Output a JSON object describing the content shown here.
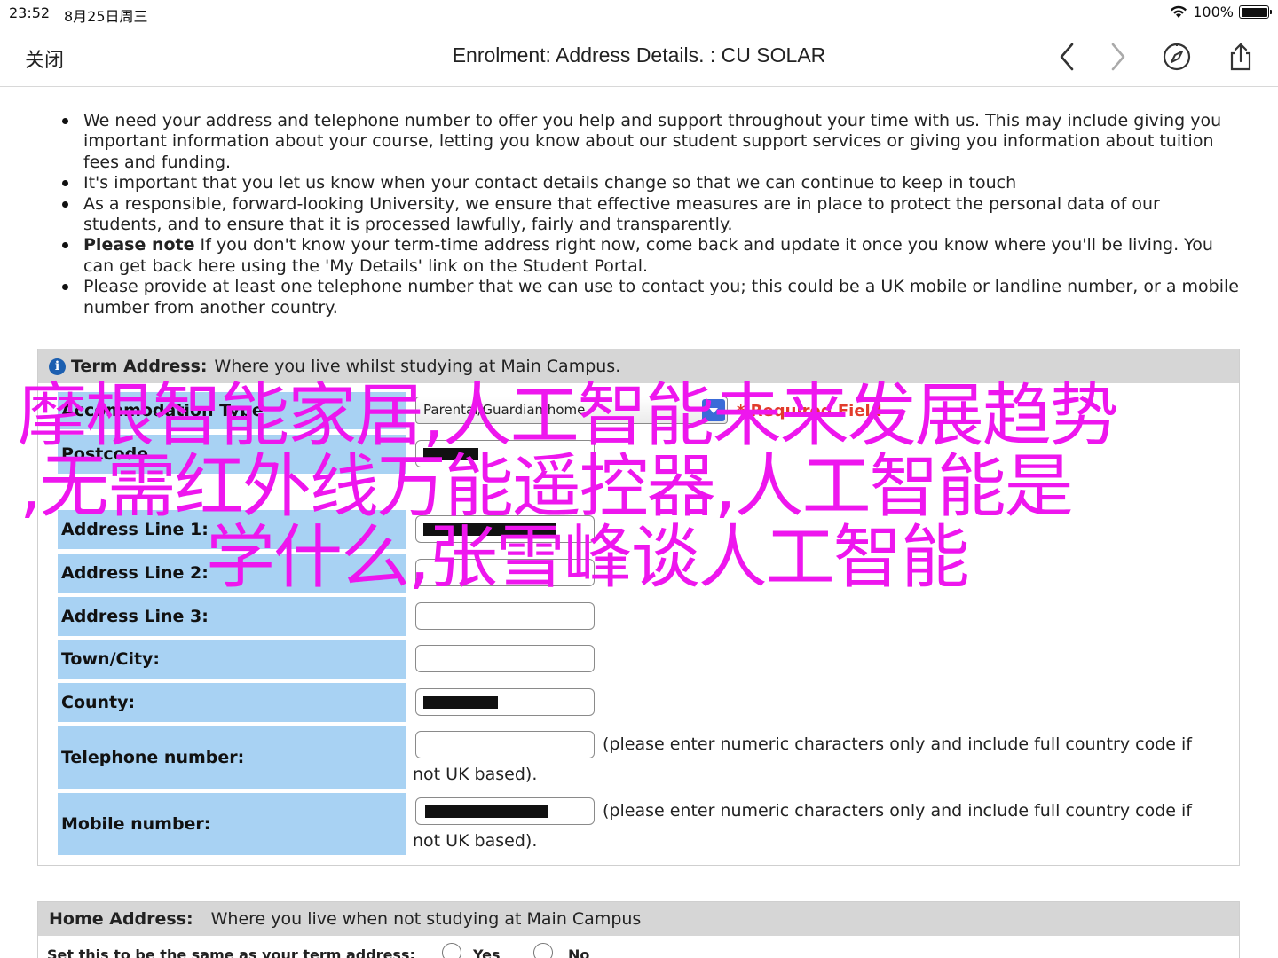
{
  "status": {
    "time": "23:52",
    "date": "8月25日周三",
    "battery": "100%"
  },
  "nav": {
    "close_label": "关闭",
    "title": "Enrolment: Address Details. : CU SOLAR"
  },
  "intro": [
    "We need your address and telephone number to offer you help and support throughout your time with us. This may include giving you important information about your course, letting you know about our student support services or giving you information about tuition fees and funding.",
    "It's important that you let us know when your contact details change so that we can continue to keep in touch",
    "As a responsible, forward-looking University, we ensure that effective measures are in place to protect the personal data of our students, and to ensure that it is processed lawfully, fairly and transparently."
  ],
  "intro_note": {
    "bold": "Please note",
    "text": " If you don't know your term-time address right now, come back and update it once you know where you'll be living. You can get back here using the 'My Details' link on the Student Portal."
  },
  "intro_last": "Please provide at least one telephone number that we can use to contact you; this could be a UK mobile or landline number, or a mobile number from another country.",
  "term": {
    "heading_bold": "Term Address:",
    "heading_text": "Where you live whilst studying at Main Campus.",
    "accommodation_label": "Accommodation Type",
    "accommodation_value": "Parental/Guardian home",
    "required": "* Required Field",
    "postcode_label": "Postcode",
    "line1_label": "Address Line 1:",
    "line2_label": "Address Line 2:",
    "line3_label": "Address Line 3:",
    "town_label": "Town/City:",
    "county_label": "County:",
    "telephone_label": "Telephone number:",
    "telephone_hint_1": "(please enter numeric characters only and include full country code if",
    "telephone_hint_2": "not UK based).",
    "mobile_label": "Mobile number:",
    "mobile_hint_1": "(please enter numeric characters only and include full country code if",
    "mobile_hint_2": "not UK based)."
  },
  "home": {
    "heading_bold": "Home Address:",
    "heading_text": "Where you live when not studying at Main Campus",
    "same_label": "Set this to be the same as your term address:",
    "yes": "Yes",
    "no": "No"
  },
  "watermark": {
    "line1": "摩根智能家居,人工智能未来发展趋势",
    "line2": ",无需红外线万能遥控器,人工智能是",
    "line3": "学什么,张雪峰谈人工智能"
  },
  "colors": {
    "label_bg": "#a8d2f3",
    "header_bg": "#d6d6d6",
    "watermark": "#ee16ee",
    "info_icon": "#1c5fb0"
  }
}
